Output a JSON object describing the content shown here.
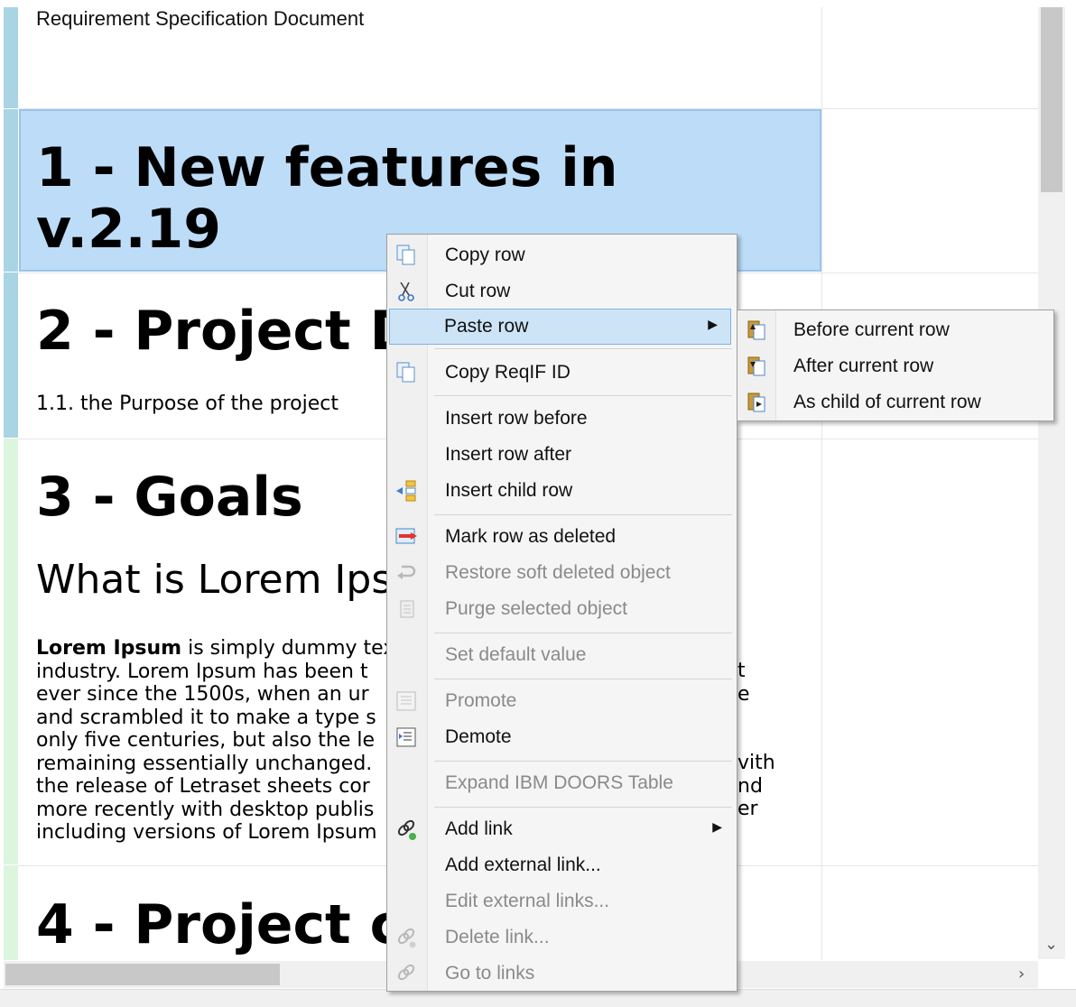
{
  "document": {
    "title": "Requirement Specification Document",
    "rows": [
      {
        "heading": "1 - New features in",
        "heading_line2": "v.2.19"
      },
      {
        "heading": "2 - Project D",
        "subtext": "1.1. the Purpose of the project"
      },
      {
        "heading": "3 - Goals",
        "subheading": "What is Lorem Ips",
        "paragraph": [
          {
            "bold": "Lorem Ipsum",
            "text": " is simply dummy tex"
          },
          {
            "text": "industry. Lorem Ipsum has been t",
            "tail": "t"
          },
          {
            "text": "ever since the 1500s, when an ur",
            "tail": "e"
          },
          {
            "text": "and scrambled it to make a type s"
          },
          {
            "text": "only five centuries, but also the le"
          },
          {
            "text": "remaining essentially unchanged.",
            "tail": "vith"
          },
          {
            "text": "the release of Letraset sheets cor",
            "tail": "nd"
          },
          {
            "text": "more recently with desktop publis",
            "tail": "er"
          },
          {
            "text": "including versions of Lorem Ipsum"
          }
        ]
      },
      {
        "heading": "4 - Project c"
      }
    ]
  },
  "context_menu": {
    "items": [
      {
        "label": "Copy row",
        "icon": "copy-icon"
      },
      {
        "label": "Cut row",
        "icon": "scissors-icon"
      },
      {
        "label": "Paste row",
        "icon": "",
        "submenu": true
      },
      {
        "label": "Copy ReqIF ID",
        "icon": "copy-icon"
      },
      {
        "label": "Insert row before"
      },
      {
        "label": "Insert row after"
      },
      {
        "label": "Insert child row",
        "icon": "insert-child-icon"
      },
      {
        "label": "Mark row as deleted",
        "icon": "mark-deleted-icon"
      },
      {
        "label": "Restore soft deleted object",
        "icon": "restore-icon",
        "disabled": true
      },
      {
        "label": "Purge selected object",
        "icon": "purge-icon",
        "disabled": true
      },
      {
        "label": "Set default value",
        "disabled": true
      },
      {
        "label": "Promote",
        "icon": "promote-icon",
        "disabled": true
      },
      {
        "label": "Demote",
        "icon": "demote-icon"
      },
      {
        "label": "Expand IBM DOORS Table",
        "disabled": true
      },
      {
        "label": "Add link",
        "icon": "link-add-icon",
        "submenu": true
      },
      {
        "label": "Add external link..."
      },
      {
        "label": "Edit external links...",
        "disabled": true
      },
      {
        "label": "Delete link...",
        "icon": "link-delete-icon",
        "disabled": true
      },
      {
        "label": "Go to links",
        "icon": "link-goto-icon",
        "disabled": true
      }
    ]
  },
  "paste_submenu": {
    "items": [
      {
        "label": "Before current row",
        "icon": "paste-before-icon"
      },
      {
        "label": "After current row",
        "icon": "paste-after-icon"
      },
      {
        "label": "As child of current row",
        "icon": "paste-child-icon"
      }
    ]
  },
  "colors": {
    "selection": "#bddcf7",
    "menu_highlight": "#cde4f7",
    "bar_blue": "#a9d4e4",
    "bar_green": "#dbf6dd"
  }
}
